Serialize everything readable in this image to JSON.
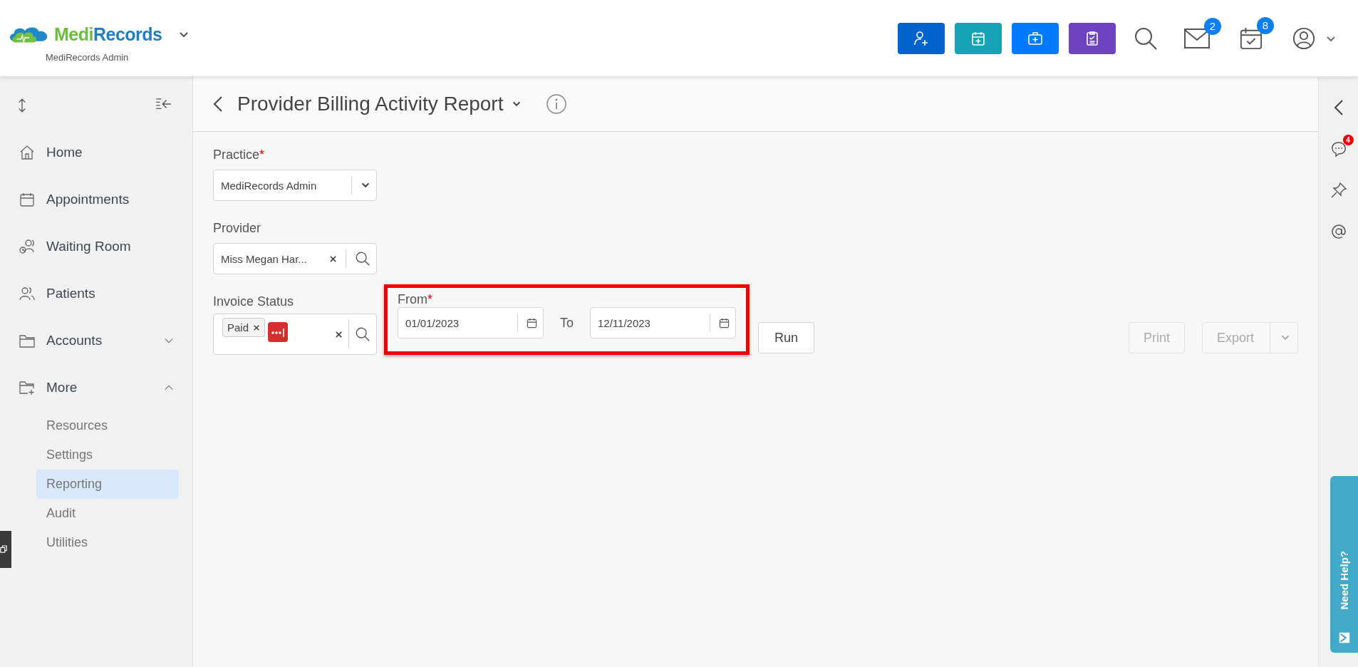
{
  "header": {
    "logo": {
      "part1": "Medi",
      "part2": "Records"
    },
    "practice_name": "MediRecords Admin",
    "quick_buttons": [
      {
        "kind": "add-person",
        "color": "#0062cc"
      },
      {
        "kind": "calendar-plus",
        "color": "#17a2b8"
      },
      {
        "kind": "medkit",
        "color": "#007bff"
      },
      {
        "kind": "clipboard",
        "color": "#6f42c1"
      }
    ],
    "messages_badge": "2",
    "tasks_badge": "8"
  },
  "sidebar": {
    "items": [
      {
        "label": "Home"
      },
      {
        "label": "Appointments"
      },
      {
        "label": "Waiting Room"
      },
      {
        "label": "Patients"
      },
      {
        "label": "Accounts",
        "expanded": false
      },
      {
        "label": "More",
        "expanded": true,
        "children": [
          {
            "label": "Resources",
            "selected": false
          },
          {
            "label": "Settings",
            "selected": false
          },
          {
            "label": "Reporting",
            "selected": true
          },
          {
            "label": "Audit",
            "selected": false
          },
          {
            "label": "Utilities",
            "selected": false
          }
        ]
      }
    ]
  },
  "page": {
    "title": "Provider Billing Activity Report",
    "practice": {
      "label": "Practice",
      "required_mark": "*",
      "value": "MediRecords Admin"
    },
    "provider": {
      "label": "Provider",
      "value": "Miss Megan Har..."
    },
    "invoice_status": {
      "label": "Invoice Status",
      "chips": [
        "Paid"
      ]
    },
    "date_range": {
      "highlighted": true,
      "from_label": "From",
      "required_mark": "*",
      "from": "01/01/2023",
      "to_label": "To",
      "to": "12/11/2023"
    },
    "run_button": "Run",
    "print_button": {
      "label": "Print",
      "disabled": true
    },
    "export_button": {
      "label": "Export",
      "disabled": true
    }
  },
  "right_rail": {
    "comments_badge": "4",
    "help_tab": "Need Help?"
  }
}
